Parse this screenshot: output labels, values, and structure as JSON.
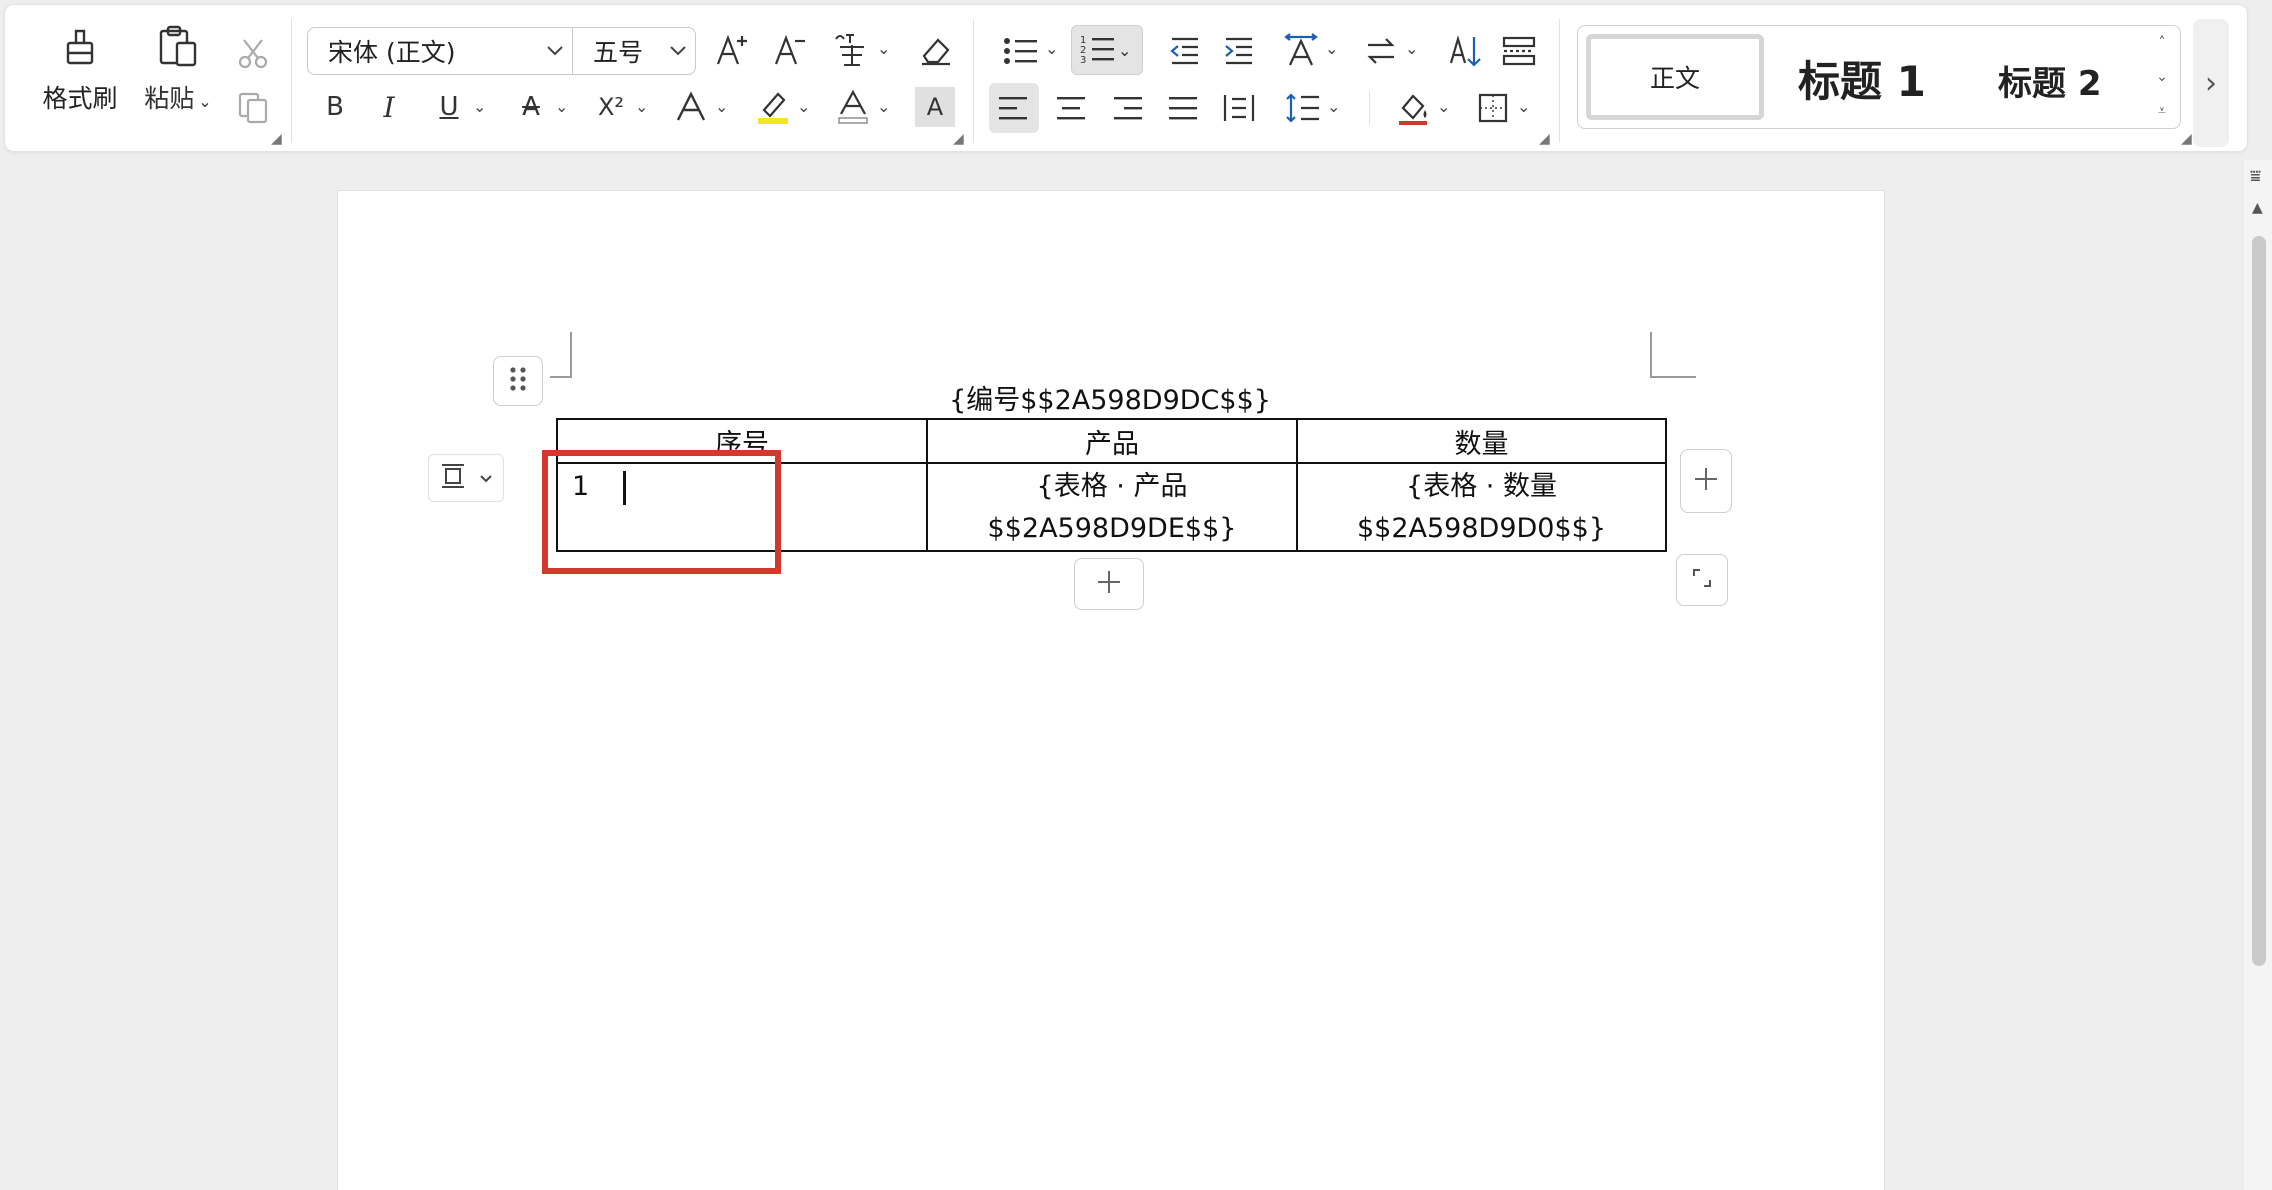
{
  "ribbon": {
    "clipboard": {
      "format_painter_label": "格式刷",
      "paste_label": "粘贴"
    },
    "font": {
      "family": "宋体 (正文)",
      "size": "五号",
      "superscript_label": "X²"
    },
    "styles": {
      "normal_label": "正文",
      "heading1_label": "标题 1",
      "heading2_label": "标题 2"
    }
  },
  "document": {
    "title": "{编号$$2A598D9DC$$}",
    "table": {
      "headers": [
        "序号",
        "产品",
        "数量"
      ],
      "rows": [
        [
          "1",
          "{表格 · 产品 $$2A598D9DE$$}",
          "{表格 · 数量 $$2A598D9D0$$}"
        ]
      ]
    }
  },
  "colors": {
    "highlight_box": "#d0392b",
    "highlight_marker": "#f5e623",
    "active_button_bg": "#e4e4e4"
  }
}
